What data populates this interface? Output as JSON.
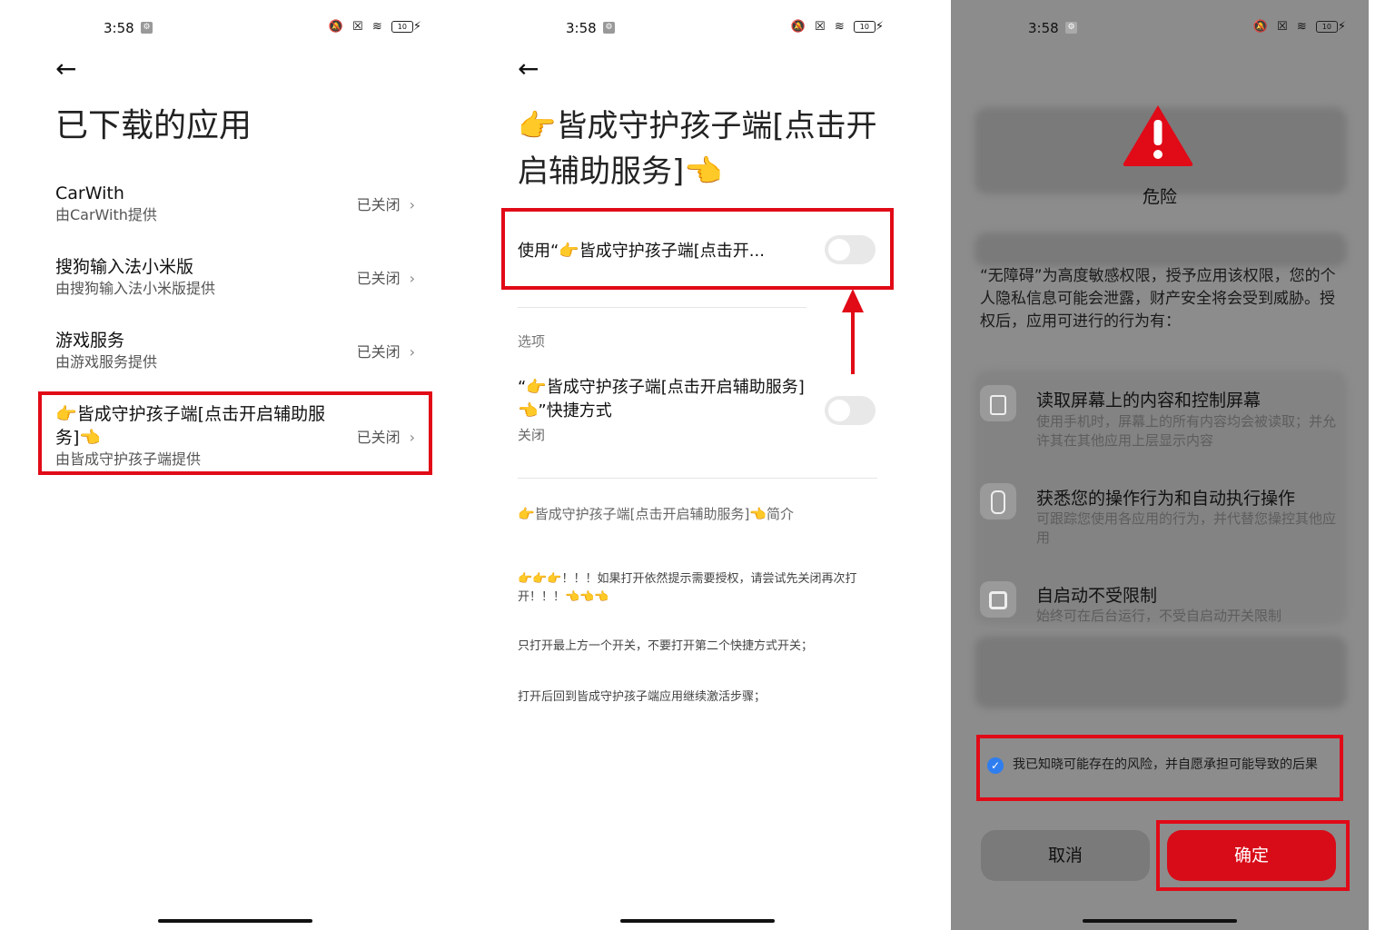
{
  "status": {
    "time": "3:58",
    "battery": "10"
  },
  "panel1": {
    "title": "已下载的应用",
    "apps": [
      {
        "name": "CarWith",
        "sub": "由CarWith提供",
        "state": "已关闭"
      },
      {
        "name": "搜狗输入法小米版",
        "sub": "由搜狗输入法小米版提供",
        "state": "已关闭"
      },
      {
        "name": "游戏服务",
        "sub": "由游戏服务提供",
        "state": "已关闭"
      },
      {
        "name": "👉皆成守护孩子端[点击开启辅助服务]👈",
        "sub": "由皆成守护孩子端提供",
        "state": "已关闭"
      }
    ]
  },
  "panel2": {
    "title": "👉皆成守护孩子端[点击开启辅助服务]👈",
    "use_label": "使用“👉皆成守护孩子端[点击开...",
    "options_label": "选项",
    "shortcut_label": "“👉皆成守护孩子端[点击开启辅助服务]👈”快捷方式",
    "shortcut_state": "关闭",
    "intro_title": "👉皆成守护孩子端[点击开启辅助服务]👈简介",
    "notes": [
      "👉👉👉！！！如果打开依然提示需要授权，请尝试先关闭再次打开！！！👈👈👈",
      "只打开最上方一个开关，不要打开第二个快捷方式开关；",
      "打开后回到皆成守护孩子端应用继续激活步骤；"
    ]
  },
  "panel3": {
    "danger_title": "危险",
    "warning_text": "“无障碍”为高度敏感权限，授予应用该权限，您的个人隐私信息可能会泄露，财产安全将会受到威胁。授权后，应用可进行的行为有：",
    "permissions": [
      {
        "title": "读取屏幕上的内容和控制屏幕",
        "desc": "使用手机时，屏幕上的所有内容均会被读取；并允许其在其他应用上层显示内容"
      },
      {
        "title": "获悉您的操作行为和自动执行操作",
        "desc": "可跟踪您使用各应用的行为，并代替您操控其他应用"
      },
      {
        "title": "自启动不受限制",
        "desc": "始终可在后台运行，不受自启动开关限制"
      }
    ],
    "consent_text": "我已知晓可能存在的风险，并自愿承担可能导致的后果",
    "cancel_label": "取消",
    "confirm_label": "确定"
  }
}
